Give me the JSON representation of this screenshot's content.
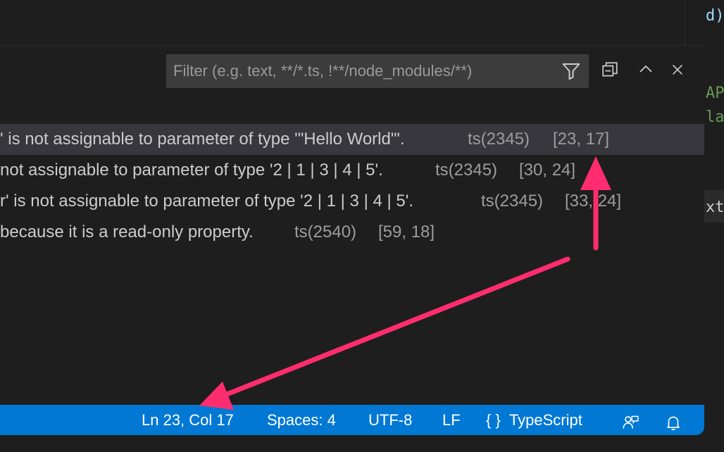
{
  "editor_fragments": {
    "line1": "d)",
    "line2": "AP",
    "line3": "la",
    "line4": "xt,"
  },
  "filter": {
    "placeholder": "Filter (e.g. text, **/*.ts, !**/node_modules/**)"
  },
  "problems": [
    {
      "message": "' is not assignable to parameter of type '\"Hello World\"'.",
      "code": "ts(2345)",
      "position": "[23, 17]"
    },
    {
      "message": "not assignable to parameter of type '2 | 1 | 3 | 4 | 5'.",
      "code": "ts(2345)",
      "position": "[30, 24]"
    },
    {
      "message": "r' is not assignable to parameter of type '2 | 1 | 3 | 4 | 5'.",
      "code": "ts(2345)",
      "position": "[33, 24]"
    },
    {
      "message": "because it is a read-only property.",
      "code": "ts(2540)",
      "position": "[59, 18]"
    }
  ],
  "statusbar": {
    "cursor": "Ln 23, Col 17",
    "indent": "Spaces: 4",
    "encoding": "UTF-8",
    "eol": "LF",
    "language_icon": "{ }",
    "language": "TypeScript"
  },
  "colors": {
    "statusbar_bg": "#0078d4",
    "annotation_arrow": "#ff2d6f",
    "selected_row": "#37373d"
  },
  "icons": [
    "filter-icon",
    "collapse-all-icon",
    "chevron-up-icon",
    "close-icon",
    "feedback-icon",
    "bell-icon"
  ]
}
